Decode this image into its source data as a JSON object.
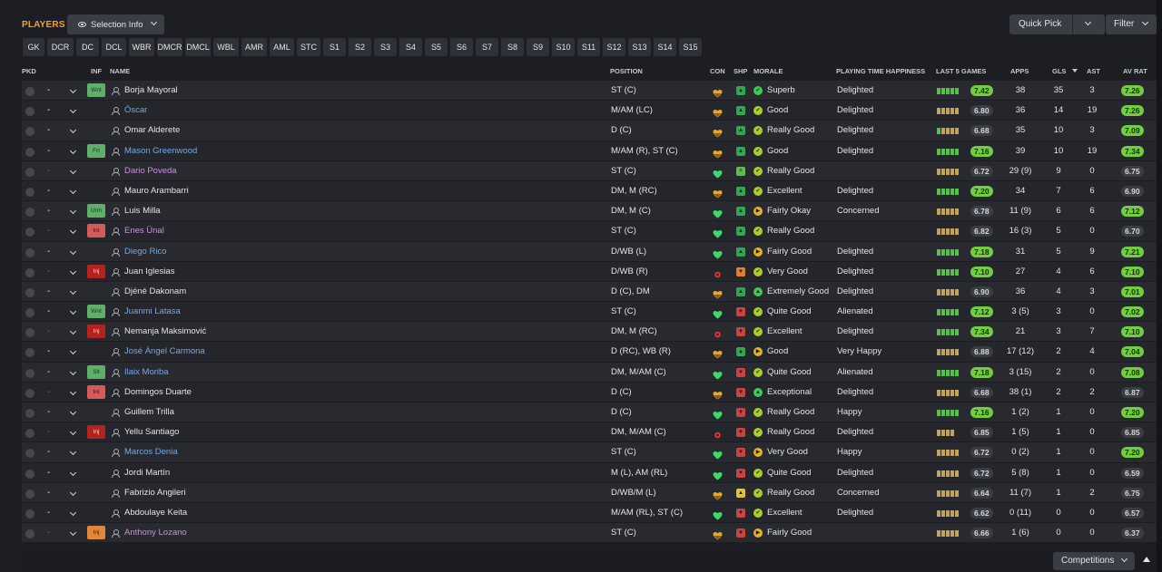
{
  "header": {
    "title": "PLAYERS",
    "selection_info": "Selection Info",
    "quick_pick": "Quick Pick",
    "filter": "Filter"
  },
  "positions": [
    "GK",
    "DCR",
    "DC",
    "DCL",
    "WBR",
    "DMCR",
    "DMCL",
    "WBL",
    "AMR",
    "AML",
    "STC",
    "S1",
    "S2",
    "S3",
    "S4",
    "S5",
    "S6",
    "S7",
    "S8",
    "S9",
    "S10",
    "S11",
    "S12",
    "S13",
    "S14",
    "S15"
  ],
  "columns": {
    "pkd": "PKD",
    "inf": "INF",
    "name": "NAME",
    "position": "POSITION",
    "con": "CON",
    "shp": "SHP",
    "morale": "MORALE",
    "pth": "PLAYING TIME HAPPINESS",
    "l5": "LAST 5 GAMES",
    "apps": "APPS",
    "gls": "GLS",
    "ast": "AST",
    "avr": "AV RAT"
  },
  "colors": {
    "accent": "#f0a32a",
    "good_rating": "#6fcf3d",
    "injury": "#b3221f",
    "name_blue": "#7aa7e0"
  },
  "players": [
    {
      "dash": "-",
      "inf": "Wnt",
      "inf_class": "wnt",
      "name": "Borja Mayoral",
      "name_class": "",
      "position": "ST (C)",
      "con": "half",
      "shp": "up",
      "morale_icon": "superb",
      "morale": "Superb",
      "pth": "Delighted",
      "bars": "ggggg",
      "l5": "7.42",
      "l5_class": "g",
      "apps": "38",
      "gls": "35",
      "ast": "3",
      "avr": "7.26",
      "avr_class": "g"
    },
    {
      "dash": "-",
      "inf": "",
      "inf_class": "",
      "name": "Óscar",
      "name_class": "blue",
      "position": "M/AM (LC)",
      "con": "half",
      "shp": "up",
      "morale_icon": "good",
      "morale": "Good",
      "pth": "Delighted",
      "bars": "ooooo",
      "l5": "6.80",
      "l5_class": "d",
      "apps": "36",
      "gls": "14",
      "ast": "19",
      "avr": "7.26",
      "avr_class": "g"
    },
    {
      "dash": "-",
      "inf": "",
      "inf_class": "",
      "name": "Omar Alderete",
      "name_class": "",
      "position": "D (C)",
      "con": "half",
      "shp": "up",
      "morale_icon": "good",
      "morale": "Really Good",
      "pth": "Delighted",
      "bars": "goooo",
      "l5": "6.68",
      "l5_class": "d",
      "apps": "35",
      "gls": "10",
      "ast": "3",
      "avr": "7.09",
      "avr_class": "g"
    },
    {
      "dash": "-",
      "inf": "Frt",
      "inf_class": "frt",
      "name": "Mason Greenwood",
      "name_class": "blue",
      "position": "M/AM (R), ST (C)",
      "con": "half",
      "shp": "up",
      "morale_icon": "good",
      "morale": "Good",
      "pth": "Delighted",
      "bars": "ggggg",
      "l5": "7.16",
      "l5_class": "g",
      "apps": "39",
      "gls": "10",
      "ast": "19",
      "avr": "7.34",
      "avr_class": "g"
    },
    {
      "dash": "-",
      "dash_red": true,
      "inf": "",
      "inf_class": "",
      "name": "Dario Poveda",
      "name_class": "purple",
      "position": "ST (C)",
      "con": "full",
      "shp": "mid",
      "morale_icon": "good",
      "morale": "Really Good",
      "pth": "",
      "bars": "ooooo",
      "l5": "6.72",
      "l5_class": "d",
      "apps": "29 (9)",
      "gls": "9",
      "ast": "0",
      "avr": "6.75",
      "avr_class": "d"
    },
    {
      "dash": "-",
      "inf": "",
      "inf_class": "",
      "name": "Mauro Arambarri",
      "name_class": "",
      "position": "DM, M (RC)",
      "con": "half",
      "shp": "up",
      "morale_icon": "good",
      "morale": "Excellent",
      "pth": "Delighted",
      "bars": "ggggg",
      "l5": "7.20",
      "l5_class": "g",
      "apps": "34",
      "gls": "7",
      "ast": "6",
      "avr": "6.90",
      "avr_class": "d"
    },
    {
      "dash": "-",
      "inf": "Unh",
      "inf_class": "unh",
      "name": "Luis Milla",
      "name_class": "",
      "position": "DM, M (C)",
      "con": "full",
      "shp": "up",
      "morale_icon": "okay",
      "morale": "Fairly Okay",
      "pth": "Concerned",
      "bars": "ooooo",
      "l5": "6.78",
      "l5_class": "d",
      "apps": "11 (9)",
      "gls": "6",
      "ast": "6",
      "avr": "7.12",
      "avr_class": "g"
    },
    {
      "dash": "-",
      "dash_red": true,
      "inf": "Int",
      "inf_class": "int",
      "name": "Enes Ünal",
      "name_class": "purple",
      "position": "ST (C)",
      "con": "full",
      "shp": "up",
      "morale_icon": "good",
      "morale": "Really Good",
      "pth": "",
      "bars": "ooooo",
      "l5": "6.82",
      "l5_class": "d",
      "apps": "16 (3)",
      "gls": "5",
      "ast": "0",
      "avr": "6.70",
      "avr_class": "d"
    },
    {
      "dash": "-",
      "inf": "",
      "inf_class": "",
      "name": "Diego Rico",
      "name_class": "blue",
      "position": "D/WB (L)",
      "con": "full",
      "shp": "up",
      "morale_icon": "okay",
      "morale": "Fairly Good",
      "pth": "Delighted",
      "bars": "ggggg",
      "l5": "7.18",
      "l5_class": "g",
      "apps": "31",
      "gls": "5",
      "ast": "9",
      "avr": "7.21",
      "avr_class": "g"
    },
    {
      "dash": "-",
      "dash_red": true,
      "inf": "Inj",
      "inf_class": "inj",
      "name": "Juan Iglesias",
      "name_class": "",
      "position": "D/WB (R)",
      "con": "injury",
      "shp": "orange",
      "morale_icon": "good",
      "morale": "Very Good",
      "pth": "Delighted",
      "bars": "ggggg",
      "l5": "7.10",
      "l5_class": "g",
      "apps": "27",
      "gls": "4",
      "ast": "6",
      "avr": "7.10",
      "avr_class": "g"
    },
    {
      "dash": "-",
      "inf": "",
      "inf_class": "",
      "name": "Djéné Dakonam",
      "name_class": "",
      "position": "D (C), DM",
      "con": "half",
      "shp": "up",
      "morale_icon": "exg",
      "morale": "Extremely Good",
      "pth": "Delighted",
      "bars": "ooooo",
      "l5": "6.90",
      "l5_class": "d",
      "apps": "36",
      "gls": "4",
      "ast": "3",
      "avr": "7.01",
      "avr_class": "g"
    },
    {
      "dash": "-",
      "inf": "Wnt",
      "inf_class": "wnt",
      "name": "Juanmi Latasa",
      "name_class": "blue",
      "position": "ST (C)",
      "con": "full",
      "shp": "down",
      "morale_icon": "good",
      "morale": "Quite Good",
      "pth": "Alienated",
      "bars": "ggggg",
      "l5": "7.12",
      "l5_class": "g",
      "apps": "3 (5)",
      "gls": "3",
      "ast": "0",
      "avr": "7.02",
      "avr_class": "g"
    },
    {
      "dash": "-",
      "dash_red": true,
      "inf": "Inj",
      "inf_class": "inj",
      "name": "Nemanja Maksimović",
      "name_class": "",
      "position": "DM, M (RC)",
      "con": "injury",
      "shp": "down",
      "morale_icon": "good",
      "morale": "Excellent",
      "pth": "Delighted",
      "bars": "ggggg",
      "l5": "7.34",
      "l5_class": "g",
      "apps": "21",
      "gls": "3",
      "ast": "7",
      "avr": "7.10",
      "avr_class": "g"
    },
    {
      "dash": "-",
      "inf": "",
      "inf_class": "",
      "name": "José Ángel Carmona",
      "name_class": "blue",
      "position": "D (RC), WB (R)",
      "con": "half",
      "shp": "up",
      "morale_icon": "okay",
      "morale": "Good",
      "pth": "Very Happy",
      "bars": "ooooo",
      "l5": "6.88",
      "l5_class": "d",
      "apps": "17 (12)",
      "gls": "2",
      "ast": "4",
      "avr": "7.04",
      "avr_class": "g"
    },
    {
      "dash": "-",
      "inf": "Slt",
      "inf_class": "slt",
      "name": "Ilaix Moriba",
      "name_class": "blue",
      "position": "DM, M/AM (C)",
      "con": "full",
      "shp": "down",
      "morale_icon": "good",
      "morale": "Quite Good",
      "pth": "Alienated",
      "bars": "ggggg",
      "l5": "7.18",
      "l5_class": "g",
      "apps": "3 (15)",
      "gls": "2",
      "ast": "0",
      "avr": "7.08",
      "avr_class": "g"
    },
    {
      "dash": "-",
      "dash_red": true,
      "inf": "Int",
      "inf_class": "int",
      "name": "Domingos Duarte",
      "name_class": "",
      "position": "D (C)",
      "con": "half",
      "shp": "down",
      "morale_icon": "exg",
      "morale": "Exceptional",
      "pth": "Delighted",
      "bars": "ooooo",
      "l5": "6.68",
      "l5_class": "d",
      "apps": "38 (1)",
      "gls": "2",
      "ast": "2",
      "avr": "6.87",
      "avr_class": "d"
    },
    {
      "dash": "-",
      "inf": "",
      "inf_class": "",
      "name": "Guillem Trilla",
      "name_class": "",
      "position": "D (C)",
      "con": "full",
      "shp": "down",
      "morale_icon": "good",
      "morale": "Really Good",
      "pth": "Happy",
      "bars": "ggggg",
      "l5": "7.16",
      "l5_class": "g",
      "apps": "1 (2)",
      "gls": "1",
      "ast": "0",
      "avr": "7.20",
      "avr_class": "g"
    },
    {
      "dash": "-",
      "dash_red": true,
      "inf": "Inj",
      "inf_class": "inj",
      "name": "Yellu Santiago",
      "name_class": "",
      "position": "DM, M/AM (C)",
      "con": "injury",
      "shp": "down",
      "morale_icon": "good",
      "morale": "Really Good",
      "pth": "Delighted",
      "bars": "oooo",
      "l5": "6.85",
      "l5_class": "d",
      "apps": "1 (5)",
      "gls": "1",
      "ast": "0",
      "avr": "6.85",
      "avr_class": "d"
    },
    {
      "dash": "-",
      "inf": "",
      "inf_class": "",
      "name": "Marcos Denia",
      "name_class": "blue",
      "position": "ST (C)",
      "con": "full",
      "shp": "down",
      "morale_icon": "okay",
      "morale": "Very Good",
      "pth": "Happy",
      "bars": "ooooo",
      "l5": "6.72",
      "l5_class": "d",
      "apps": "0 (2)",
      "gls": "1",
      "ast": "0",
      "avr": "7.20",
      "avr_class": "g"
    },
    {
      "dash": "-",
      "inf": "",
      "inf_class": "",
      "name": "Jordi Martín",
      "name_class": "",
      "position": "M (L), AM (RL)",
      "con": "full",
      "shp": "down",
      "morale_icon": "good",
      "morale": "Quite Good",
      "pth": "Delighted",
      "bars": "ooooo",
      "l5": "6.72",
      "l5_class": "d",
      "apps": "5 (8)",
      "gls": "1",
      "ast": "0",
      "avr": "6.59",
      "avr_class": "d"
    },
    {
      "dash": "-",
      "inf": "",
      "inf_class": "",
      "name": "Fabrizio Angileri",
      "name_class": "",
      "position": "D/WB/M (L)",
      "con": "half",
      "shp": "yellow",
      "morale_icon": "good",
      "morale": "Really Good",
      "pth": "Concerned",
      "bars": "ooooo",
      "l5": "6.64",
      "l5_class": "d",
      "apps": "11 (7)",
      "gls": "1",
      "ast": "2",
      "avr": "6.75",
      "avr_class": "d"
    },
    {
      "dash": "-",
      "inf": "",
      "inf_class": "",
      "name": "Abdoulaye Keita",
      "name_class": "",
      "position": "M/AM (RL), ST (C)",
      "con": "full",
      "shp": "down",
      "morale_icon": "good",
      "morale": "Excellent",
      "pth": "Delighted",
      "bars": "ooooo",
      "l5": "6.62",
      "l5_class": "d",
      "apps": "0 (11)",
      "gls": "0",
      "ast": "0",
      "avr": "6.57",
      "avr_class": "d"
    },
    {
      "dash": "-",
      "dash_red": true,
      "inf": "Inj",
      "inf_class": "inj2",
      "name": "Anthony Lozano",
      "name_class": "purple",
      "position": "ST (C)",
      "con": "half",
      "shp": "down",
      "morale_icon": "okay",
      "morale": "Fairly Good",
      "pth": "",
      "bars": "ooooo",
      "l5": "6.66",
      "l5_class": "d",
      "apps": "1 (6)",
      "gls": "0",
      "ast": "0",
      "avr": "6.37",
      "avr_class": "d"
    }
  ],
  "footer": {
    "competitions": "Competitions"
  }
}
